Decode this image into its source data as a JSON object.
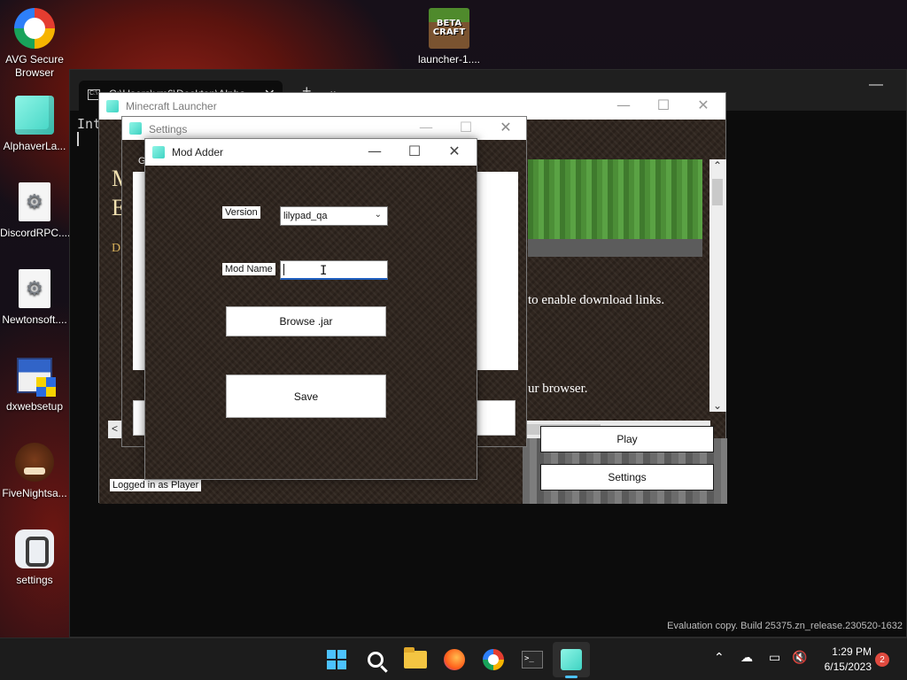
{
  "desktop": {
    "icons": [
      {
        "label": "AVG Secure Browser",
        "icon": "avg-browser-icon"
      },
      {
        "label": "AlphaverLa...",
        "icon": "cube-app-icon"
      },
      {
        "label": "DiscordRPC....",
        "icon": "dll-file-icon"
      },
      {
        "label": "Newtonsoft....",
        "icon": "dll-file-icon"
      },
      {
        "label": "dxwebsetup",
        "icon": "installer-icon"
      },
      {
        "label": "FiveNightsa...",
        "icon": "fnaf-game-icon"
      },
      {
        "label": "settings",
        "icon": "settings-app-icon"
      },
      {
        "label": "launcher-1....",
        "icon": "beta-craft-icon"
      }
    ],
    "beta_craft_text": "BETA CRAFT"
  },
  "terminal": {
    "tab_title": "C:\\Users\\vm6\\Desktop\\Alpha",
    "tab_close": "✕",
    "new_tab": "+",
    "dropdown": "⌄",
    "minimize": "—",
    "output": "Int",
    "watermark": "Evaluation copy. Build 25375.zn_release.230520-1632"
  },
  "launcher": {
    "title": "Minecraft Launcher",
    "minimize": "—",
    "maximize": "☐",
    "close": "✕",
    "news_heading_1": "M",
    "news_heading_2": "E",
    "news_link": "D",
    "news_text_1": "to enable download links.",
    "news_text_2": "ur browser.",
    "play_button": "Play",
    "settings_button": "Settings",
    "status": "Logged in as Player",
    "scroll_up": "⌃",
    "scroll_down": "⌄",
    "scroll_left": "<",
    "scroll_right": ">"
  },
  "settings_window": {
    "title": "Settings",
    "minimize": "—",
    "maximize": "☐",
    "close": "✕",
    "group_label": "G"
  },
  "mod_adder": {
    "title": "Mod Adder",
    "minimize": "—",
    "maximize": "☐",
    "close": "✕",
    "version_label": "Version",
    "version_value": "lilypad_qa",
    "mod_name_label": "Mod Name",
    "mod_name_value": "",
    "browse_button": "Browse .jar",
    "save_button": "Save"
  },
  "taskbar": {
    "items": [
      "start",
      "search",
      "file-explorer",
      "firefox",
      "avg-browser",
      "terminal",
      "alphaver-launcher"
    ],
    "active": "alphaver-launcher",
    "tray": {
      "chevron": "⌃",
      "time": "1:29 PM",
      "date": "6/15/2023",
      "notification_count": "2"
    }
  },
  "colors": {
    "accent": "#4cc2ff",
    "dirt": "#2e241d",
    "grass": "#4b8a36",
    "focus_underline": "#1f5fbf"
  }
}
